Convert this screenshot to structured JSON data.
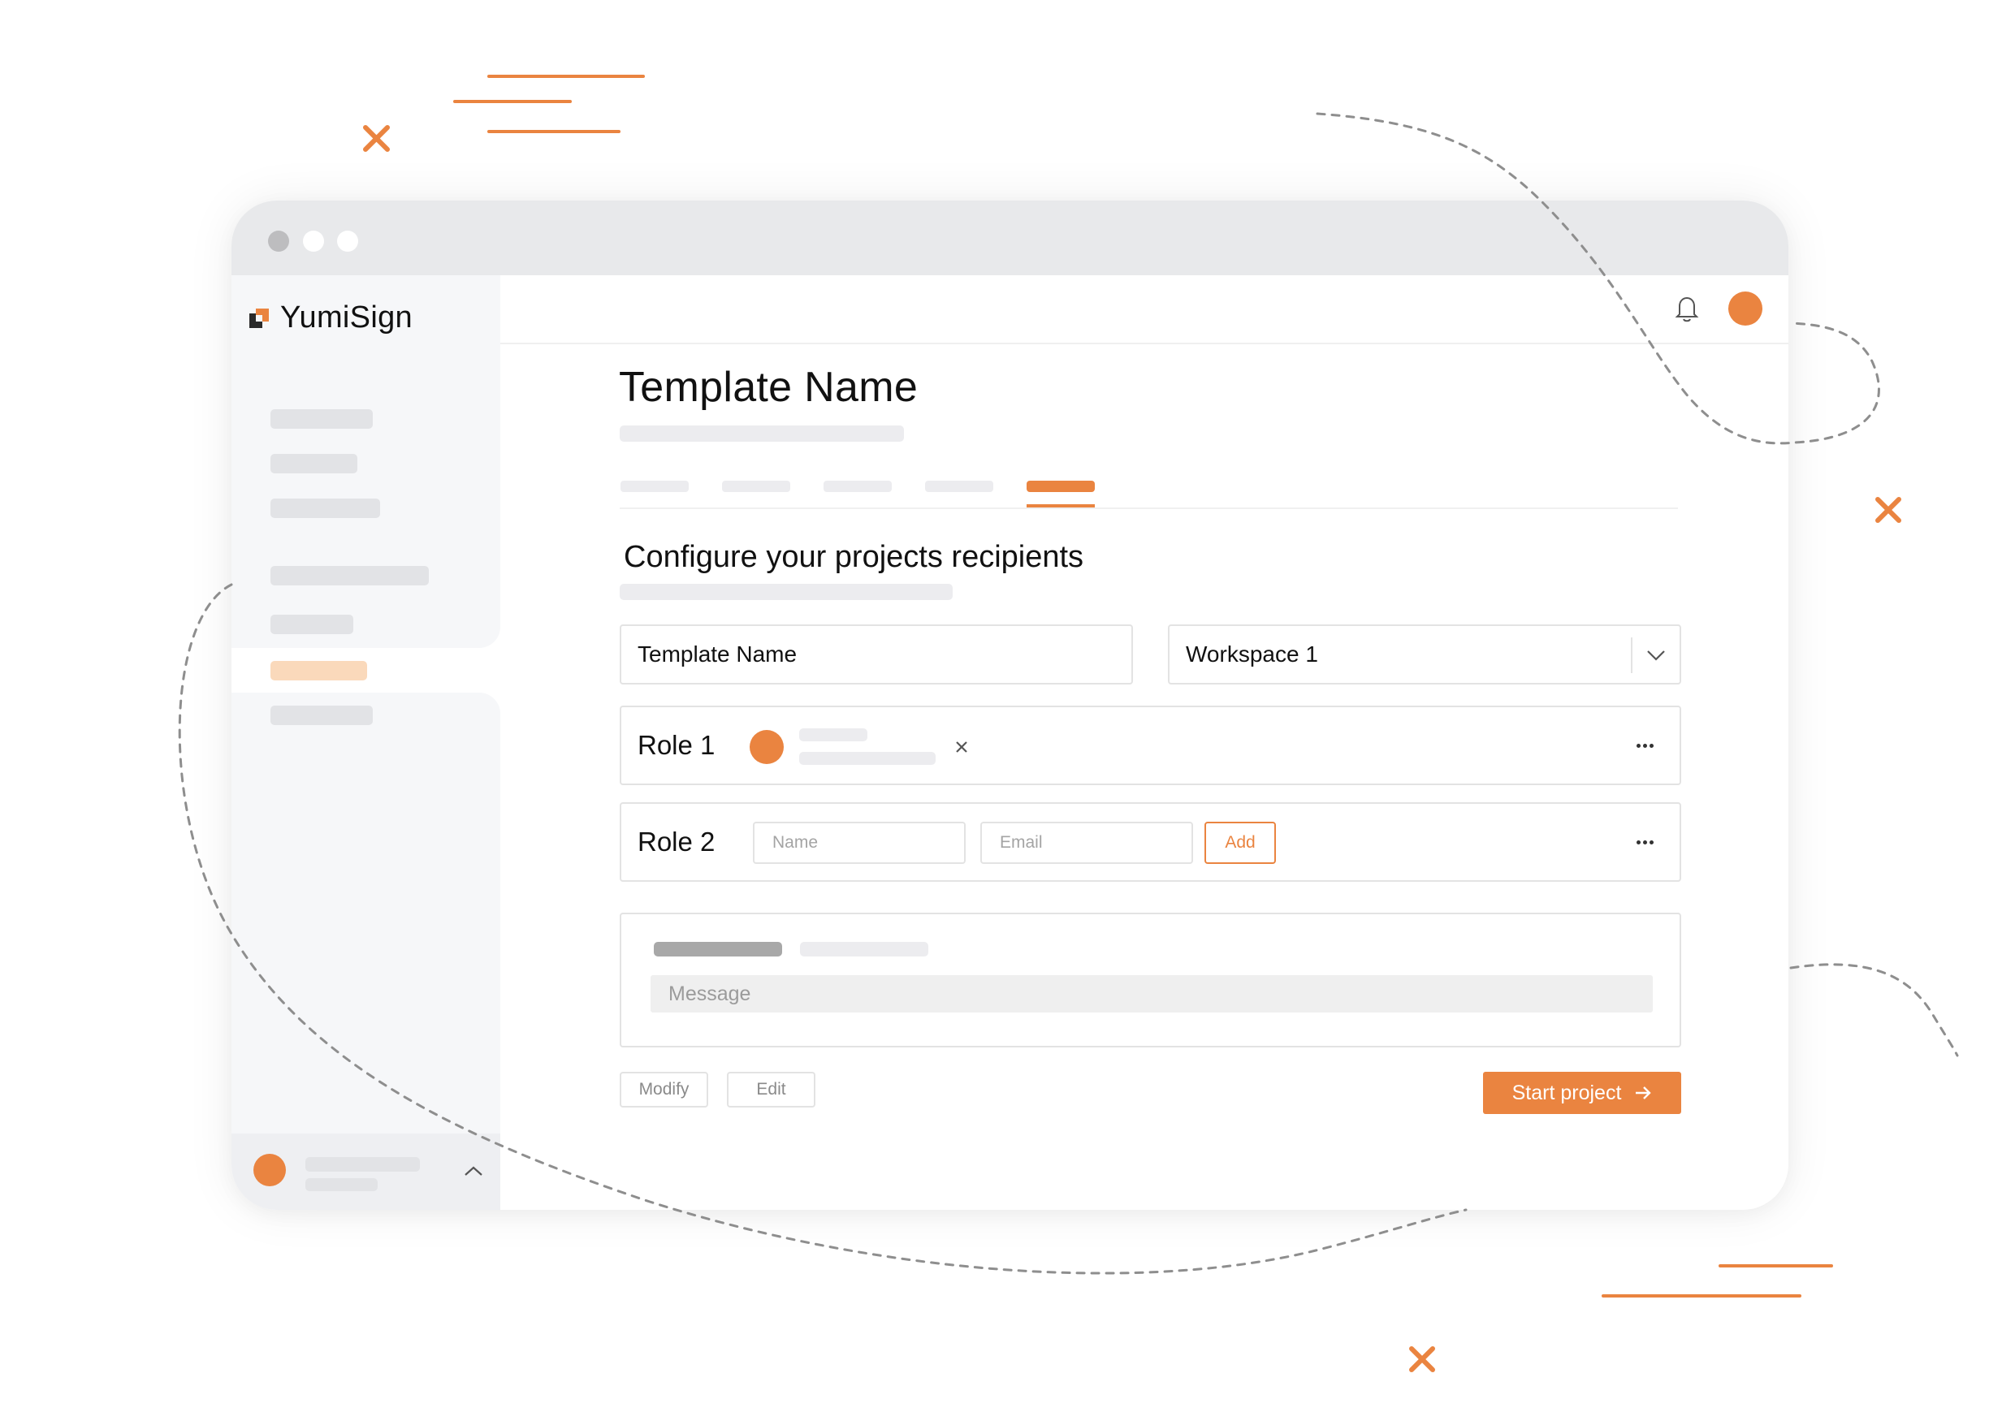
{
  "brand": {
    "name": "YumiSign",
    "accent_color": "#ea8440",
    "logo_icon": "yumisign-logo-icon"
  },
  "header": {
    "notification_icon": "bell-icon",
    "avatar": "user-avatar"
  },
  "sidebar": {
    "items": [
      {
        "state": "placeholder"
      },
      {
        "state": "placeholder"
      },
      {
        "state": "placeholder"
      },
      {
        "state": "placeholder"
      },
      {
        "state": "placeholder"
      },
      {
        "state": "active"
      },
      {
        "state": "placeholder"
      }
    ],
    "footer": {
      "expand_icon": "chevron-up-icon"
    }
  },
  "main": {
    "page_title": "Template Name",
    "tabs": [
      {
        "state": "inactive"
      },
      {
        "state": "inactive"
      },
      {
        "state": "inactive"
      },
      {
        "state": "inactive"
      },
      {
        "state": "active"
      }
    ],
    "section_title": "Configure your projects recipients",
    "template_name_field": {
      "value": "Template Name"
    },
    "workspace_select": {
      "value": "Workspace 1",
      "icon": "chevron-down-icon"
    },
    "roles": [
      {
        "label": "Role 1",
        "remove_icon": "close-icon",
        "menu_icon": "more-horizontal-icon"
      },
      {
        "label": "Role 2",
        "name_placeholder": "Name",
        "email_placeholder": "Email",
        "add_label": "Add",
        "menu_icon": "more-horizontal-icon"
      }
    ],
    "message": {
      "placeholder": "Message"
    },
    "actions": {
      "modify_label": "Modify",
      "edit_label": "Edit",
      "start_label": "Start project",
      "start_icon": "arrow-right-icon"
    }
  }
}
